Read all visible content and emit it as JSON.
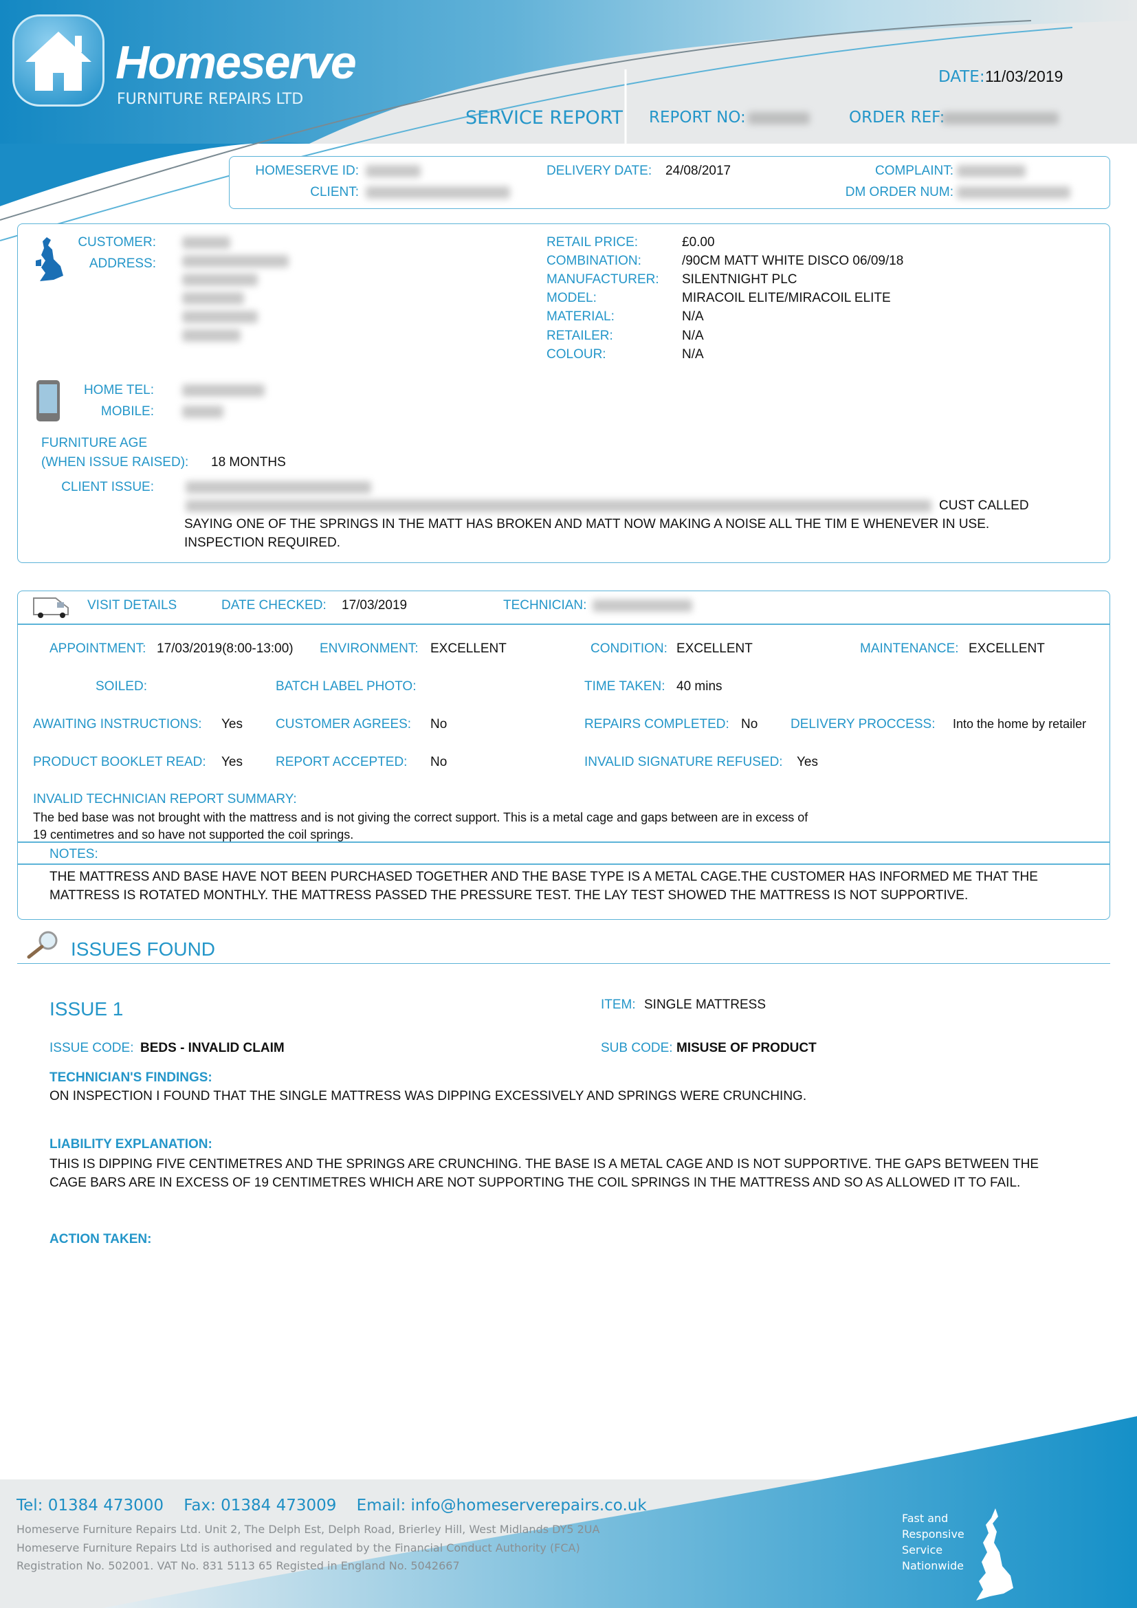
{
  "brand": {
    "name": "Homeserve",
    "subtitle": "FURNITURE REPAIRS LTD",
    "accent": "#2496c9"
  },
  "header": {
    "date_label": "DATE:",
    "date": "11/03/2019",
    "title": "SERVICE REPORT",
    "report_no_label": "REPORT NO:",
    "order_ref_label": "ORDER REF:"
  },
  "summary": {
    "homeserve_id_label": "HOMESERVE ID:",
    "client_label": "CLIENT:",
    "delivery_date_label": "DELIVERY DATE:",
    "delivery_date": "24/08/2017",
    "complaint_label": "COMPLAINT:",
    "dm_order_label": "DM ORDER NUM:"
  },
  "customer": {
    "customer_label": "CUSTOMER:",
    "address_label": "ADDRESS:",
    "home_tel_label": "HOME TEL:",
    "mobile_label": "MOBILE:",
    "age_label_1": "FURNITURE AGE",
    "age_label_2": "(WHEN ISSUE RAISED):",
    "age": "18 MONTHS",
    "client_issue_label": "CLIENT ISSUE:",
    "client_issue_1": "CUST CALLED",
    "client_issue_2": "SAYING ONE OF THE SPRINGS IN THE MATT HAS BROKEN AND MATT NOW MAKING A NOISE ALL THE TIM E WHENEVER IN USE.",
    "client_issue_3": "INSPECTION REQUIRED.",
    "product": [
      {
        "label": "RETAIL PRICE:",
        "value": "£0.00"
      },
      {
        "label": "COMBINATION:",
        "value": "/90CM MATT WHITE DISCO 06/09/18"
      },
      {
        "label": "MANUFACTURER:",
        "value": "SILENTNIGHT PLC"
      },
      {
        "label": "MODEL:",
        "value": "MIRACOIL ELITE/MIRACOIL ELITE"
      },
      {
        "label": "MATERIAL:",
        "value": "N/A"
      },
      {
        "label": "RETAILER:",
        "value": "N/A"
      },
      {
        "label": "COLOUR:",
        "value": "N/A"
      }
    ]
  },
  "visit": {
    "title": "VISIT DETAILS",
    "date_checked_label": "DATE CHECKED:",
    "date_checked": "17/03/2019",
    "technician_label": "TECHNICIAN:",
    "appointment_label": "APPOINTMENT:",
    "appointment": "17/03/2019(8:00-13:00)",
    "environment_label": "ENVIRONMENT:",
    "environment": "EXCELLENT",
    "condition_label": "CONDITION:",
    "condition": "EXCELLENT",
    "maintenance_label": "MAINTENANCE:",
    "maintenance": "EXCELLENT",
    "soiled_label": "SOILED:",
    "batch_label": "BATCH LABEL PHOTO:",
    "time_taken_label": "TIME TAKEN:",
    "time_taken": "40 mins",
    "awaiting_label": "AWAITING INSTRUCTIONS:",
    "awaiting": "Yes",
    "customer_agrees_label": "CUSTOMER AGREES:",
    "customer_agrees": "No",
    "repairs_label": "REPAIRS COMPLETED:",
    "repairs": "No",
    "delivery_label": "DELIVERY PROCCESS:",
    "delivery": "Into the home by retailer",
    "booklet_label": "PRODUCT BOOKLET READ:",
    "booklet": "Yes",
    "report_accepted_label": "REPORT ACCEPTED:",
    "report_accepted": "No",
    "sig_label": "INVALID SIGNATURE REFUSED:",
    "sig": "Yes",
    "summary_label": "INVALID TECHNICIAN REPORT SUMMARY:",
    "summary_1": "The bed base was not brought with the mattress and is not giving the correct support. This is a metal cage and gaps between are in excess of",
    "summary_2": "19 centimetres and so have not supported the coil springs.",
    "notes_label": "NOTES:",
    "notes": "THE MATTRESS AND BASE HAVE NOT BEEN PURCHASED TOGETHER AND THE BASE TYPE IS A METAL CAGE.THE CUSTOMER HAS INFORMED ME THAT THE MATTRESS IS ROTATED MONTHLY. THE MATTRESS PASSED THE PRESSURE TEST. THE LAY TEST SHOWED THE MATTRESS IS NOT SUPPORTIVE."
  },
  "issues": {
    "title": "ISSUES FOUND",
    "issue_title": "ISSUE 1",
    "item_label": "ITEM:",
    "item": "SINGLE MATTRESS",
    "code_label": "ISSUE CODE:",
    "code": "BEDS - INVALID CLAIM",
    "sub_label": "SUB CODE:",
    "sub": "MISUSE OF PRODUCT",
    "findings_label": "TECHNICIAN'S FINDINGS:",
    "findings": "ON INSPECTION I FOUND THAT THE SINGLE MATTRESS WAS DIPPING EXCESSIVELY AND SPRINGS WERE CRUNCHING.",
    "liability_label": "LIABILITY EXPLANATION:",
    "liability": "THIS IS DIPPING FIVE CENTIMETRES AND THE SPRINGS ARE CRUNCHING. THE BASE IS A METAL CAGE AND IS NOT SUPPORTIVE. THE GAPS BETWEEN THE CAGE BARS ARE IN EXCESS OF 19 CENTIMETRES WHICH ARE NOT SUPPORTING THE COIL SPRINGS IN THE MATTRESS AND SO AS ALLOWED IT TO FAIL.",
    "action_label": "ACTION TAKEN:"
  },
  "footer": {
    "contact": "Tel: 01384 473000    Fax: 01384 473009    Email: info@homeserverepairs.co.uk",
    "line1": "Homeserve Furniture Repairs Ltd. Unit 2, The Delph Est, Delph Road, Brierley Hill, West Midlands DY5 2UA",
    "line2": "Homeserve Furniture Repairs Ltd is authorised and regulated by the Financial Conduct Authority (FCA)",
    "line3": "Registration No. 502001. VAT No. 831 5113 65 Registed in England No. 5042667",
    "tag1": "Fast and",
    "tag2": "Responsive",
    "tag3": "Service",
    "tag4": "Nationwide"
  }
}
